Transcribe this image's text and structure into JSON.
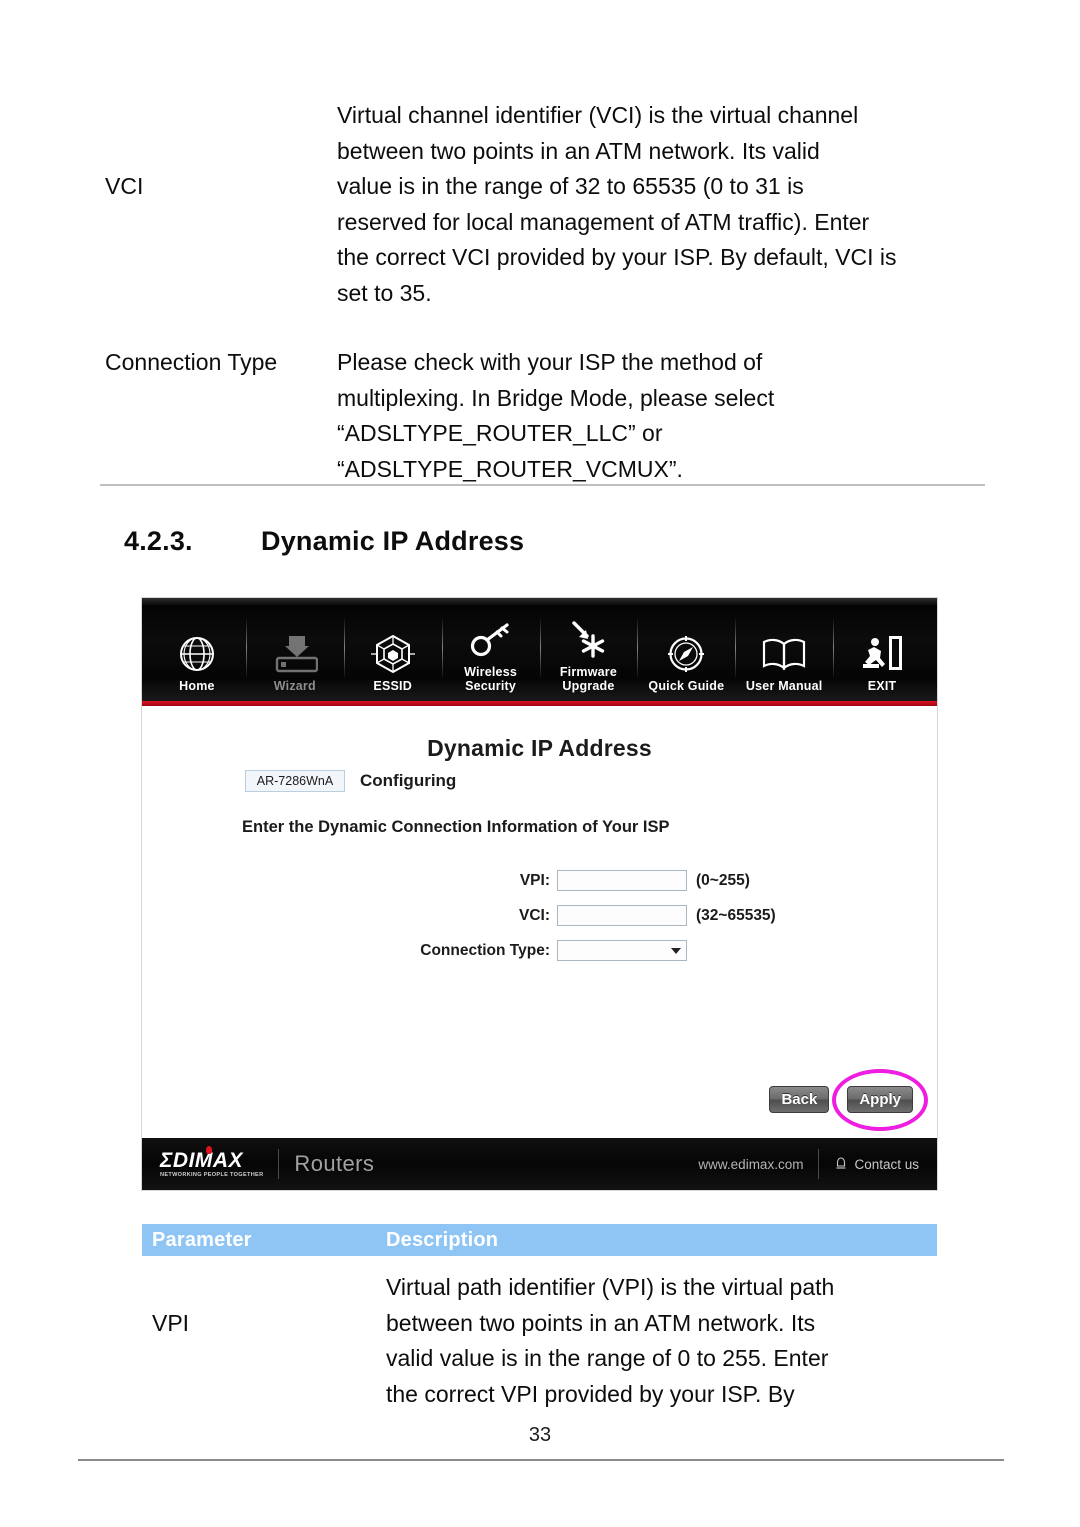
{
  "document": {
    "page_number": "33",
    "continued_table": {
      "rows": [
        {
          "parameter": "VCI",
          "description_lines": [
            "Virtual channel identifier (VCI) is the virtual channel",
            "between two points in an ATM network. Its valid",
            "value is in the range of 32 to 65535 (0 to 31 is",
            "reserved for local management of ATM traffic). Enter",
            "the correct VCI provided by your ISP. By default, VCI is",
            "set to 35."
          ]
        },
        {
          "parameter": "Connection Type",
          "description_lines": [
            "Please check with your ISP the method of",
            "multiplexing. In Bridge Mode, please select",
            "“ADSLTYPE_ROUTER_LLC” or",
            "“ADSLTYPE_ROUTER_VCMUX”."
          ]
        }
      ]
    },
    "heading": {
      "number": "4.2.3.",
      "title": "Dynamic IP Address"
    },
    "parameter_table": {
      "columns": [
        "Parameter",
        "Description"
      ],
      "header_bg": "#8fc5f5",
      "rows": [
        {
          "parameter": "VPI",
          "description_lines": [
            "Virtual path identifier (VPI) is the virtual path",
            "between two points in an ATM network. Its",
            "valid value is in the range of 0 to 255. Enter",
            "the correct VPI provided by your ISP. By"
          ]
        }
      ]
    }
  },
  "router_ui": {
    "nav": {
      "items": [
        {
          "label": "Home",
          "icon": "globe-icon",
          "dim": false
        },
        {
          "label": "Wizard",
          "icon": "wizard-download-icon",
          "dim": true
        },
        {
          "label": "ESSID",
          "icon": "essid-web-icon",
          "dim": false
        },
        {
          "label": "Wireless\nSecurity",
          "icon": "key-icon",
          "dim": false
        },
        {
          "label": "Firmware\nUpgrade",
          "icon": "firmware-arrow-icon",
          "dim": false
        },
        {
          "label": "Quick Guide",
          "icon": "compass-icon",
          "dim": false
        },
        {
          "label": "User Manual",
          "icon": "open-book-icon",
          "dim": false
        },
        {
          "label": "EXIT",
          "icon": "exit-running-man-icon",
          "dim": false
        }
      ],
      "accent_color": "#e01020"
    },
    "page": {
      "title": "Dynamic IP Address",
      "model": "AR-7286WnA",
      "status": "Configuring",
      "instruction": "Enter the Dynamic Connection Information of Your ISP"
    },
    "form": {
      "fields": [
        {
          "label": "VPI:",
          "value": "",
          "hint": "(0~255)",
          "type": "text"
        },
        {
          "label": "VCI:",
          "value": "",
          "hint": "(32~65535)",
          "type": "text"
        },
        {
          "label": "Connection Type:",
          "value": "",
          "hint": "",
          "type": "select"
        }
      ]
    },
    "buttons": {
      "back": "Back",
      "apply": "Apply",
      "highlight_color": "#ee1ee0"
    },
    "footer": {
      "brand": "ΣDIMAX",
      "tagline": "NETWORKING PEOPLE TOGETHER",
      "category": "Routers",
      "url": "www.edimax.com",
      "contact": "Contact us"
    }
  }
}
